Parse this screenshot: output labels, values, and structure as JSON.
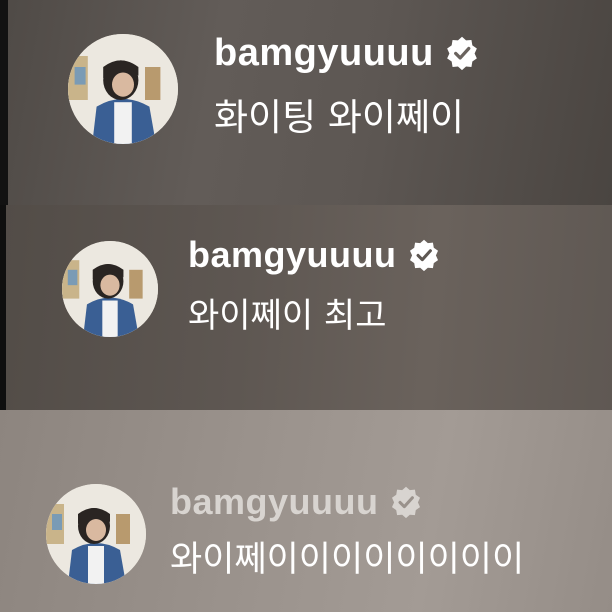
{
  "comments": [
    {
      "username": "bamgyuuuu",
      "verified_icon": "verified-badge-icon",
      "text": "화이팅 와이쩨이"
    },
    {
      "username": "bamgyuuuu",
      "verified_icon": "verified-badge-icon",
      "text": "와이쩨이 최고"
    },
    {
      "username": "bamgyuuuu",
      "verified_icon": "verified-badge-icon",
      "text": "와이쩨이이이이이이이이"
    }
  ],
  "colors": {
    "text": "#ffffff",
    "badge": "#ffffff",
    "faded_username": "#d8d4d0"
  }
}
